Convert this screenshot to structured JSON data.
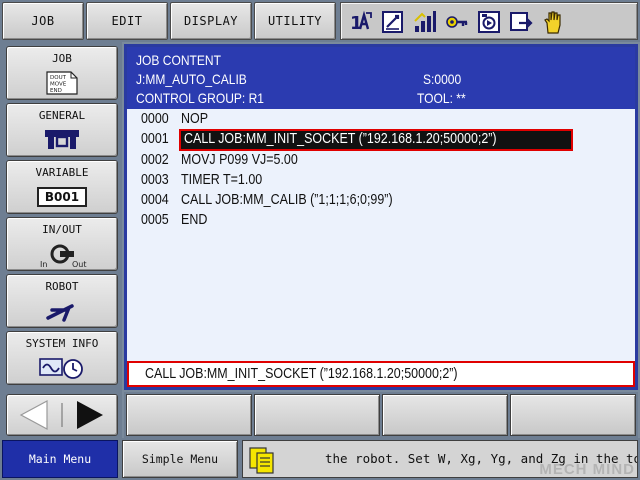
{
  "top_menu": {
    "job": "JOB",
    "edit": "EDIT",
    "display": "DISPLAY",
    "utility": "UTILITY"
  },
  "status_icons": [
    "coord-select-icon",
    "edit-mode-icon",
    "speed-level-icon",
    "security-key-icon",
    "play-mode-icon",
    "cycle-icon",
    "hand-icon"
  ],
  "left_menu": {
    "job": {
      "label": "JOB",
      "icon_text": [
        "DOUT",
        "MOVE",
        "END"
      ]
    },
    "general": {
      "label": "GENERAL"
    },
    "variable": {
      "label": "VARIABLE",
      "badge": "B001"
    },
    "inout": {
      "label": "IN/OUT",
      "in": "In",
      "out": "Out"
    },
    "robot": {
      "label": "ROBOT"
    },
    "system_info": {
      "label": "SYSTEM INFO"
    }
  },
  "job_window": {
    "title": "JOB CONTENT",
    "job_name": "J:MM_AUTO_CALIB",
    "step": "S:0000",
    "control_group": "CONTROL GROUP: R1",
    "tool": "TOOL: **",
    "lines": [
      {
        "no": "0000",
        "text": "NOP"
      },
      {
        "no": "0001",
        "text": "CALL JOB:MM_INIT_SOCKET (”192.168.1.20;50000;2”)"
      },
      {
        "no": "0002",
        "text": "MOVJ P099 VJ=5.00"
      },
      {
        "no": "0003",
        "text": "TIMER T=1.00"
      },
      {
        "no": "0004",
        "text": "CALL JOB:MM_CALIB (”1;1;1;6;0;99”)"
      },
      {
        "no": "0005",
        "text": "END"
      }
    ],
    "selected_line": 1,
    "edit_buffer": "CALL JOB:MM_INIT_SOCKET (”192.168.1.20;50000;2”)"
  },
  "bottom_bar": {
    "main_menu": "Main Menu",
    "simple_menu": "Simple Menu",
    "message": "the robot. Set W, Xg, Yg, and Zg in the tool"
  },
  "watermark": "MECH MIND",
  "colors": {
    "header_blue": "#2b3bb0",
    "highlight_red": "#e00000",
    "main_menu_blue": "#1f2fa8"
  }
}
